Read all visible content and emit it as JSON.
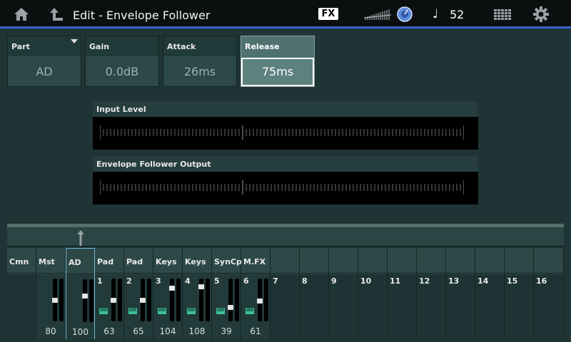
{
  "header": {
    "title": "Edit - Envelope Follower",
    "fx_label": "FX",
    "tempo_symbol": "♩",
    "tempo_value": "52"
  },
  "params": [
    {
      "label": "Part",
      "value": "AD"
    },
    {
      "label": "Gain",
      "value": "0.0dB"
    },
    {
      "label": "Attack",
      "value": "26ms"
    },
    {
      "label": "Release",
      "value": "75ms"
    }
  ],
  "panels": {
    "input_level": "Input Level",
    "envelope_output": "Envelope Follower Output"
  },
  "mixer": {
    "strips": [
      {
        "name": "Cmn",
        "num": "",
        "volume": "",
        "level": null
      },
      {
        "name": "Mst",
        "num": "",
        "volume": "80",
        "level": 0.5
      },
      {
        "name": "AD",
        "num": "",
        "volume": "100",
        "level": 0.63
      },
      {
        "name": "Pad",
        "num": "1",
        "volume": "63",
        "level": 0.5
      },
      {
        "name": "Pad",
        "num": "2",
        "volume": "65",
        "level": 0.5
      },
      {
        "name": "Keys",
        "num": "3",
        "volume": "104",
        "level": 0.82
      },
      {
        "name": "Keys",
        "num": "4",
        "volume": "108",
        "level": 0.85
      },
      {
        "name": "SynCp",
        "num": "5",
        "volume": "39",
        "level": 0.31
      },
      {
        "name": "M.FX",
        "num": "6",
        "volume": "61",
        "level": 0.48
      },
      {
        "name": "",
        "num": "7",
        "volume": "",
        "level": null
      },
      {
        "name": "",
        "num": "8",
        "volume": "",
        "level": null
      },
      {
        "name": "",
        "num": "9",
        "volume": "",
        "level": null
      },
      {
        "name": "",
        "num": "10",
        "volume": "",
        "level": null
      },
      {
        "name": "",
        "num": "11",
        "volume": "",
        "level": null
      },
      {
        "name": "",
        "num": "12",
        "volume": "",
        "level": null
      },
      {
        "name": "",
        "num": "13",
        "volume": "",
        "level": null
      },
      {
        "name": "",
        "num": "14",
        "volume": "",
        "level": null
      },
      {
        "name": "",
        "num": "15",
        "volume": "",
        "level": null
      },
      {
        "name": "",
        "num": "16",
        "volume": "",
        "level": null
      }
    ]
  },
  "colors": {
    "accent_blue": "#3d5fd0",
    "selected_border": "#6fb9d8",
    "keyboard_green": "#3fbf9a"
  }
}
